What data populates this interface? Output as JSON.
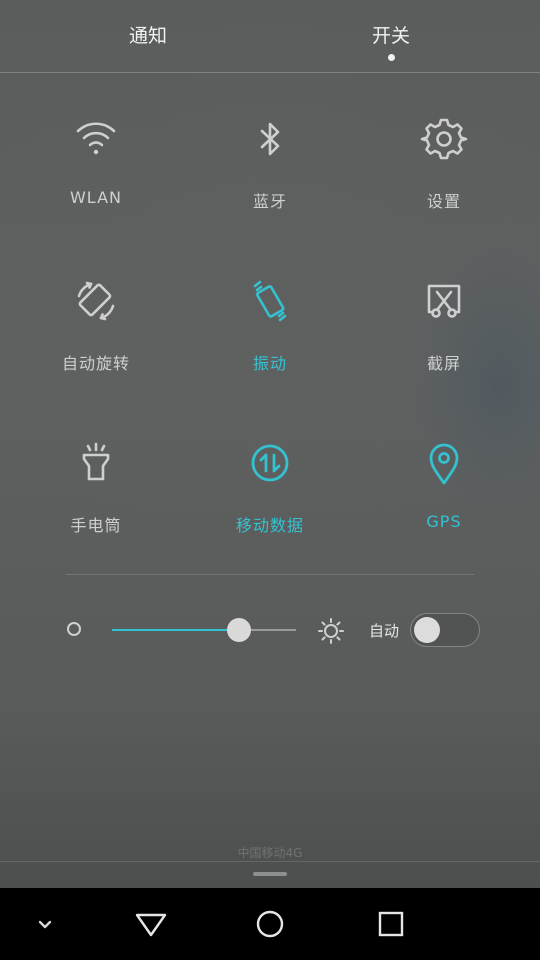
{
  "tabs": [
    {
      "label": "通知"
    },
    {
      "label": "开关"
    }
  ],
  "active_tab": "开关",
  "toggles": [
    {
      "label": "WLAN",
      "icon": "wifi-icon",
      "on": false
    },
    {
      "label": "蓝牙",
      "icon": "bluetooth-icon",
      "on": false
    },
    {
      "label": "设置",
      "icon": "gear-icon",
      "on": false
    },
    {
      "label": "自动旋转",
      "icon": "rotate-icon",
      "on": false
    },
    {
      "label": "振动",
      "icon": "vibrate-icon",
      "on": true
    },
    {
      "label": "截屏",
      "icon": "screenshot-icon",
      "on": false
    },
    {
      "label": "手电筒",
      "icon": "flashlight-icon",
      "on": false
    },
    {
      "label": "移动数据",
      "icon": "mobile-data-icon",
      "on": true
    },
    {
      "label": "GPS",
      "icon": "location-pin-icon",
      "on": true
    }
  ],
  "brightness": {
    "level": 0.69,
    "auto_label": "自动",
    "auto_enabled": false
  },
  "carrier": "中国移动4G",
  "colors": {
    "accent": "#34c2d0",
    "inactive": "#cfcfcf"
  }
}
